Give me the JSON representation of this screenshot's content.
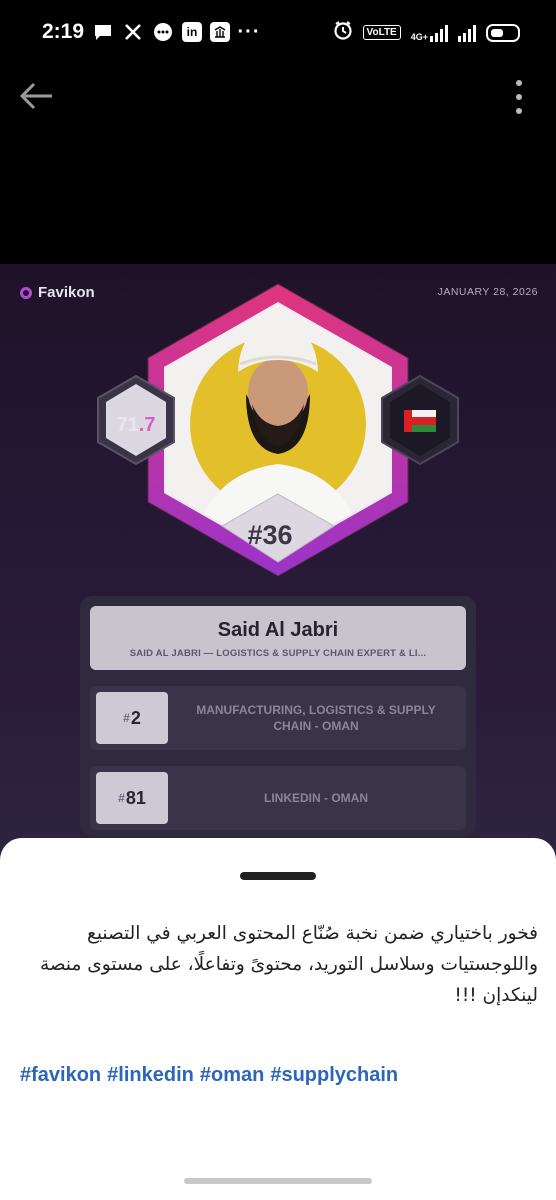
{
  "status_bar": {
    "time": "2:19",
    "notification_icons": [
      "message-icon",
      "x-icon",
      "chat-icon",
      "linkedin-icon",
      "app-icon",
      "more-icon"
    ],
    "volte": "VoLTE",
    "network": "4G+"
  },
  "post": {
    "brand": "Favikon",
    "date": "JANUARY 28, 2026",
    "score_int": "71",
    "score_dec": ".7",
    "rank_main": "#36",
    "name": "Said Al Jabri",
    "subtitle": "SAID AL JABRI — LOGISTICS & SUPPLY CHAIN EXPERT & LI...",
    "category_rank": "2",
    "category_label": "MANUFACTURING, LOGISTICS & SUPPLY CHAIN - OMAN",
    "platform_rank": "81",
    "platform_label": "LINKEDIN - OMAN",
    "hash_symbol": "#"
  },
  "sheet": {
    "caption": "فخور باختياري ضمن نخبة صُنّاع المحتوى العربي في التصنيع واللوجستيات وسلاسل التوريد، محتوىً وتفاعلًا، على مستوى منصة لينكدإن !!!",
    "hashtags": [
      "#favikon",
      "#linkedin",
      "#oman",
      "#supplychain"
    ]
  },
  "colors": {
    "hashtag": "#2b66ba",
    "accent_pink": "#e0357c",
    "accent_purple": "#9b34c9",
    "photo_bg": "#e3c02a"
  }
}
